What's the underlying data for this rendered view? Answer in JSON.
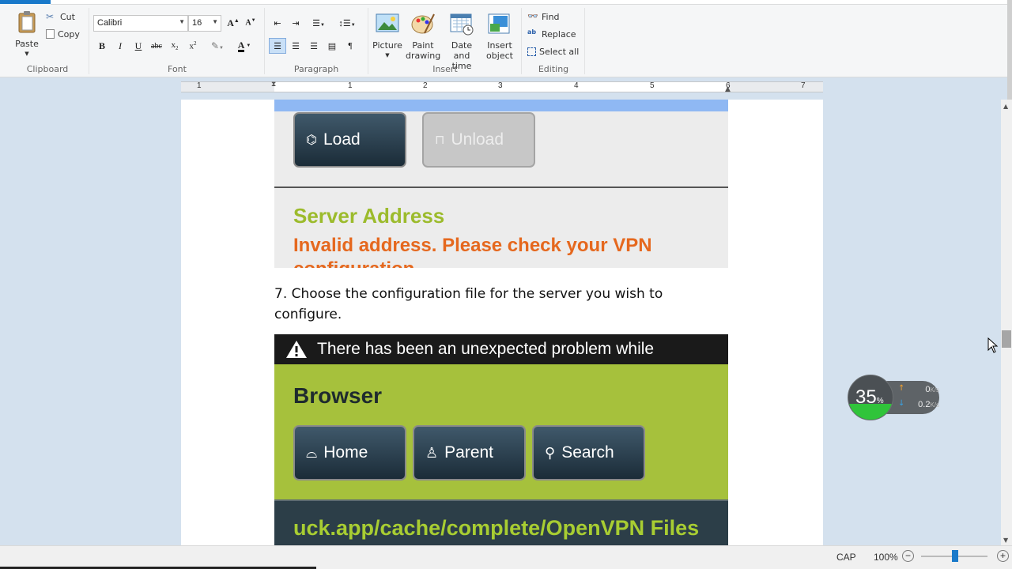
{
  "ribbon": {
    "clipboard": {
      "paste": "Paste",
      "cut": "Cut",
      "copy": "Copy",
      "label": "Clipboard"
    },
    "font": {
      "family": "Calibri",
      "size": "16",
      "label": "Font"
    },
    "paragraph": {
      "label": "Paragraph"
    },
    "insert": {
      "picture": "Picture",
      "paint_drawing": [
        "Paint",
        "drawing"
      ],
      "date_time": [
        "Date and",
        "time"
      ],
      "insert_object": [
        "Insert",
        "object"
      ],
      "label": "Insert"
    },
    "editing": {
      "find": "Find",
      "replace": "Replace",
      "select_all": "Select all",
      "label": "Editing"
    }
  },
  "ruler": {
    "numbers": [
      "1",
      "1",
      "2",
      "3",
      "4",
      "5",
      "6",
      "7"
    ]
  },
  "document": {
    "shot1": {
      "load": "Load",
      "unload": "Unload",
      "server_title": "Server Address",
      "server_error": "Invalid address. Please check your VPN configuration"
    },
    "step_text": "7. Choose the configuration file for the server you wish to configure.",
    "shot2": {
      "warning": "There has been an unexpected problem while",
      "browser_title": "Browser",
      "home": "Home",
      "parent": "Parent",
      "search": "Search",
      "path": "uck.app/cache/complete/OpenVPN Files"
    }
  },
  "status": {
    "caps": "CAP",
    "zoom": "100%",
    "zoom_level": 100
  },
  "speed_widget": {
    "percent": "35",
    "percent_sign": "%",
    "upload": "0",
    "download": "0.2",
    "unit": "K/s",
    "fill_fraction": 0.35
  },
  "colors": {
    "accent": "#1979ca",
    "server_title": "#9cbb2c",
    "error": "#e5681e",
    "browser_bg": "#a6c13c"
  }
}
